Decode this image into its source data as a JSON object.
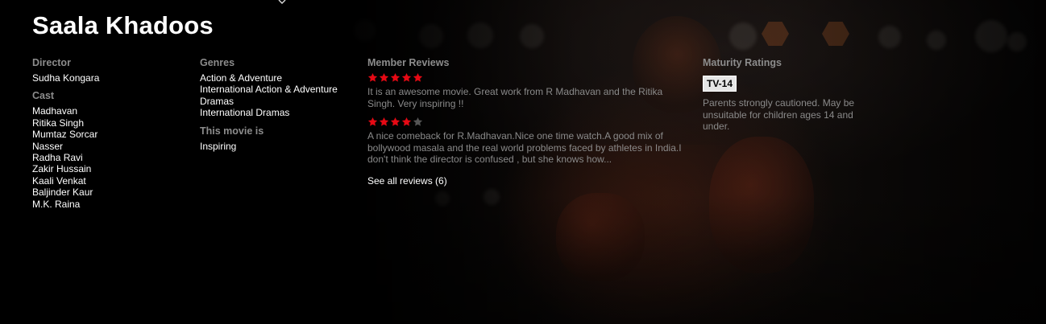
{
  "title": "Saala Khadoos",
  "director": {
    "label": "Director",
    "names": [
      "Sudha Kongara"
    ]
  },
  "cast": {
    "label": "Cast",
    "names": [
      "Madhavan",
      "Ritika Singh",
      "Mumtaz Sorcar",
      "Nasser",
      "Radha Ravi",
      "Zakir Hussain",
      "Kaali Venkat",
      "Baljinder Kaur",
      "M.K. Raina"
    ]
  },
  "genres": {
    "label": "Genres",
    "items": [
      "Action & Adventure",
      "International Action & Adventure",
      "Dramas",
      "International Dramas"
    ]
  },
  "this_movie_is": {
    "label": "This movie is",
    "items": [
      "Inspiring"
    ]
  },
  "reviews": {
    "label": "Member Reviews",
    "items": [
      {
        "stars": 5,
        "text": "It is an awesome movie. Great work from R Madhavan and the Ritika Singh. Very inspiring !!"
      },
      {
        "stars": 4,
        "text": "A nice comeback for R.Madhavan.Nice one time watch.A good mix of bollywood masala and the real world problems faced by athletes in India.I don't think the director is confused , but she knows how..."
      }
    ],
    "see_all": "See all reviews (6)"
  },
  "maturity": {
    "label": "Maturity Ratings",
    "rating": "TV-14",
    "description": "Parents strongly cautioned. May be unsuitable for children ages 14 and under."
  },
  "colors": {
    "star_filled": "#e50914",
    "star_empty": "#555555",
    "background": "#000000"
  },
  "icons": {
    "star": "star-icon"
  }
}
